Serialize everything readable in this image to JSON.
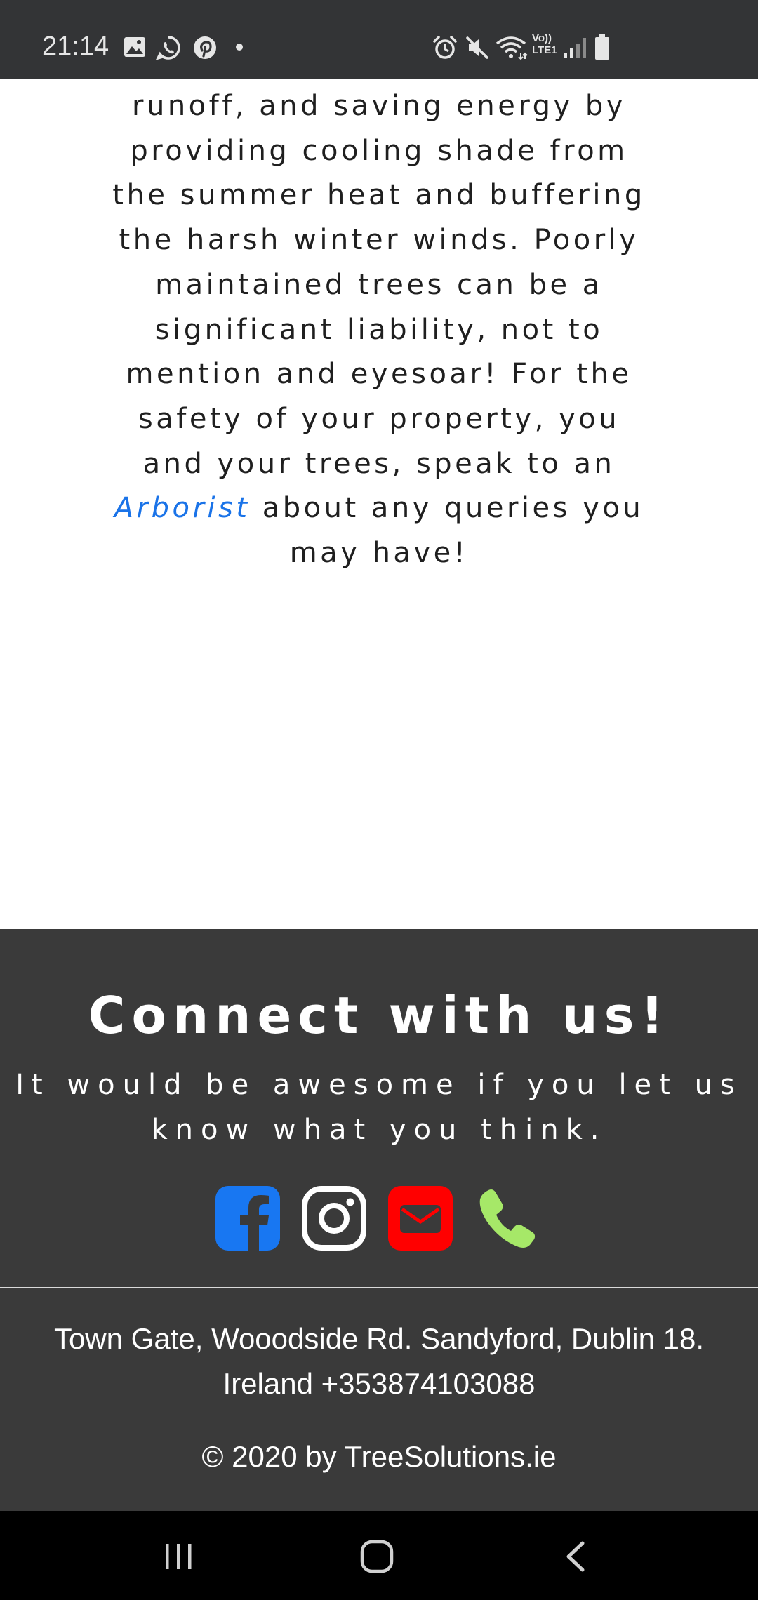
{
  "status_bar": {
    "time": "21:14",
    "left_icons": [
      "gallery-icon",
      "whatsapp-icon",
      "pinterest-icon",
      "notification-dot"
    ],
    "right_icons": [
      "alarm-icon",
      "mute-icon",
      "wifi-icon",
      "lte-icon",
      "signal-icon",
      "battery-icon"
    ],
    "lte_line1": "Vo))",
    "lte_line2": "LTE1"
  },
  "article": {
    "text_before_link": "runoff, and saving energy by providing cooling shade from the summer heat and buffering the harsh winter winds. Poorly maintained trees can be a significant liability, not to mention and eyesoar! For the safety of your property, you and your trees, speak to an ",
    "link_text": "Arborist",
    "text_after_link": " about any queries you may have!"
  },
  "footer": {
    "heading": "Connect with us!",
    "subheading": "It would be awesome if you let us know what you think.",
    "social": [
      {
        "name": "facebook",
        "icon": "facebook-icon",
        "color": "#1877f2"
      },
      {
        "name": "instagram",
        "icon": "instagram-icon",
        "color": "#ffffff"
      },
      {
        "name": "email",
        "icon": "email-icon",
        "color": "#ff0000"
      },
      {
        "name": "phone",
        "icon": "phone-icon",
        "color": "#a6e868"
      }
    ],
    "address_line1": "Town Gate, Wooodside Rd. Sandyford, Dublin 18.",
    "address_line2": "Ireland +353874103088",
    "copyright": "© 2020 by TreeSolutions.ie"
  },
  "nav_bar": {
    "buttons": [
      "recents-icon",
      "home-icon",
      "back-icon"
    ]
  },
  "colors": {
    "status_bar_bg": "#333436",
    "footer_bg": "#3a3a3a",
    "link": "#1a73e8",
    "nav_bar_bg": "#000000"
  }
}
